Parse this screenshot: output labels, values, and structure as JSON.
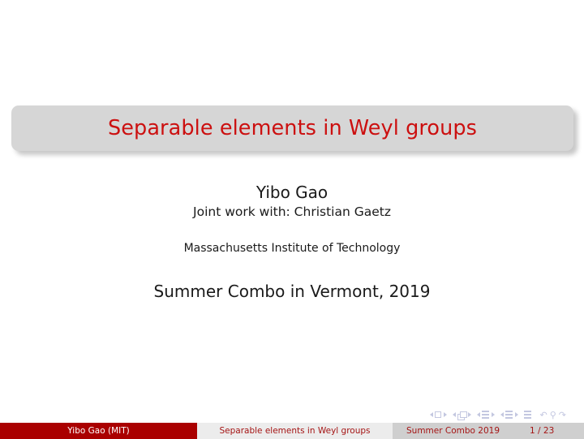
{
  "slide": {
    "title": "Separable elements in Weyl groups",
    "author_name": "Yibo Gao",
    "joint_work": "Joint work with: Christian Gaetz",
    "institute": "Massachusetts Institute of Technology",
    "event_date": "Summer Combo in Vermont, 2019"
  },
  "footline": {
    "author": "Yibo Gao  (MIT)",
    "title": "Separable elements in Weyl groups",
    "date": "Summer Combo 2019",
    "page": "1 / 23"
  },
  "navigation": {
    "icons": [
      "nav-slide-prev-icon",
      "nav-slide-icon",
      "nav-slide-next-icon",
      "nav-frame-prev-icon",
      "nav-frame-icon",
      "nav-frame-next-icon",
      "nav-subsection-prev-icon",
      "nav-subsection-icon",
      "nav-subsection-next-icon",
      "nav-section-prev-icon",
      "nav-section-icon",
      "nav-section-next-icon",
      "nav-presentation-icon",
      "nav-back-icon",
      "nav-search-icon",
      "nav-forward-icon"
    ],
    "back_glyph": "↶",
    "search_glyph": "⚲",
    "forward_glyph": "↷"
  },
  "colors": {
    "title_red": "#cc1010",
    "footer_red": "#aa0000",
    "footer_text_red": "#a51515",
    "title_box_gray": "#d6d6d6",
    "footer_light_gray": "#ececec",
    "footer_mid_gray": "#cfcfcf",
    "nav_symbol": "#c3c7e0"
  }
}
